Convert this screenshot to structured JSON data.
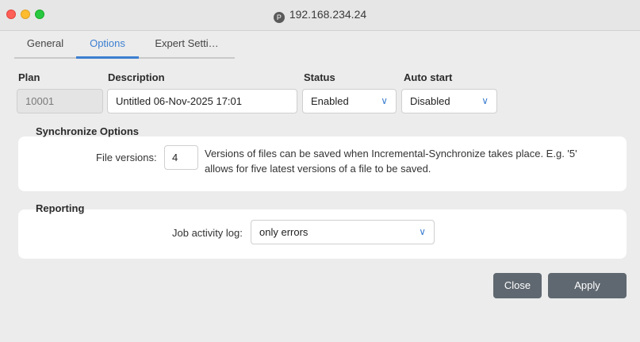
{
  "window": {
    "title": "192.168.234.24"
  },
  "tabs": [
    {
      "label": "General"
    },
    {
      "label": "Options"
    },
    {
      "label": "Expert Setti…"
    }
  ],
  "form": {
    "plan_label": "Plan",
    "plan_value": "10001",
    "description_label": "Description",
    "description_value": "Untitled 06-Nov-2025 17:01",
    "status_label": "Status",
    "status_value": "Enabled",
    "autostart_label": "Auto start",
    "autostart_value": "Disabled"
  },
  "sync": {
    "title": "Synchronize Options",
    "file_versions_label": "File versions:",
    "file_versions_value": "4",
    "description_line1": "Versions of files can be saved when Incremental-Synchronize takes place. E.g. '5'",
    "description_line2": "allows for five latest versions of a file to be saved."
  },
  "reporting": {
    "title": "Reporting",
    "log_label": "Job activity log:",
    "log_value": "only errors"
  },
  "buttons": {
    "close": "Close",
    "apply": "Apply"
  },
  "colors": {
    "accent": "#3d7fd1",
    "button": "#5f6870"
  }
}
